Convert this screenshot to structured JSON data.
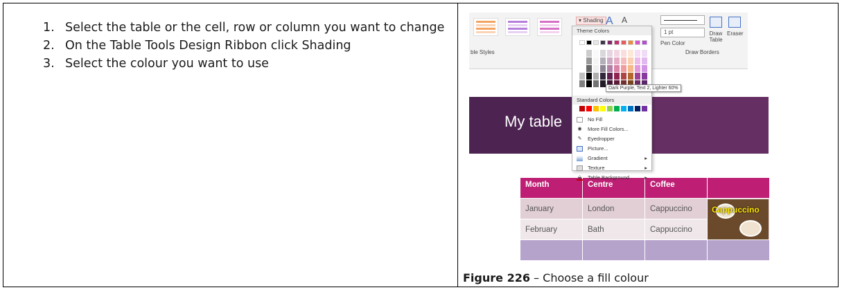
{
  "steps": [
    {
      "number": "1.",
      "text": "Select the table or the cell, row or column you want to change"
    },
    {
      "number": "2.",
      "text": "On the Table Tools Design Ribbon click Shading"
    },
    {
      "number": "3.",
      "text": "Select the colour you want to use"
    }
  ],
  "caption": {
    "figure_label": "Figure 226",
    "text": " – Choose a fill colour"
  },
  "ribbon": {
    "table_styles_label": "ble Styles",
    "shading_button": "Shading",
    "pen_weight": "1 pt",
    "pen_color": "Pen Color",
    "draw_table": "Draw Table",
    "eraser": "Eraser",
    "draw_borders": "Draw Borders"
  },
  "dropdown": {
    "theme_colors_label": "Theme Colors",
    "tooltip": "Dark Purple, Text 2, Lighter 60%",
    "standard_colors_label": "Standard Colors",
    "theme_top_row": [
      "#ffffff",
      "#000000",
      "#e7e6e6",
      "#44354f",
      "#7d2b67",
      "#c0306f",
      "#e65c5c",
      "#ef8b3c",
      "#d355c7",
      "#b44fd4"
    ],
    "theme_shade_columns": [
      "#f2f2f2",
      "#7f7f7f",
      "#cfcdcd",
      "#bfaed0",
      "#e6b6d8",
      "#f4b3cc",
      "#f7c1c1",
      "#f9d1b1",
      "#eebbe7",
      "#e2b9ef"
    ],
    "standard_colors": [
      "#c00000",
      "#ff0000",
      "#ffc000",
      "#ffff00",
      "#92d050",
      "#00b050",
      "#00b0f0",
      "#0070c0",
      "#002060",
      "#7030a0"
    ],
    "menu_items": [
      {
        "icon": "no-fill",
        "label": "No Fill"
      },
      {
        "icon": "palette",
        "label": "More Fill Colors..."
      },
      {
        "icon": "eyedropper",
        "label": "Eyedropper"
      },
      {
        "icon": "picture",
        "label": "Picture..."
      },
      {
        "icon": "gradient",
        "label": "Gradient",
        "submenu": true
      },
      {
        "icon": "texture",
        "label": "Texture",
        "submenu": true
      },
      {
        "icon": "table-background",
        "label": "Table Background",
        "submenu": true
      }
    ]
  },
  "slide": {
    "title": "My table"
  },
  "table": {
    "headers": [
      "Month",
      "Centre",
      "Coffee",
      ""
    ],
    "rows": [
      [
        "January",
        "London",
        "Cappuccino"
      ],
      [
        "February",
        "Bath",
        "Cappuccino"
      ],
      [
        "",
        "",
        ""
      ]
    ],
    "image_label": "Cappuccino"
  }
}
